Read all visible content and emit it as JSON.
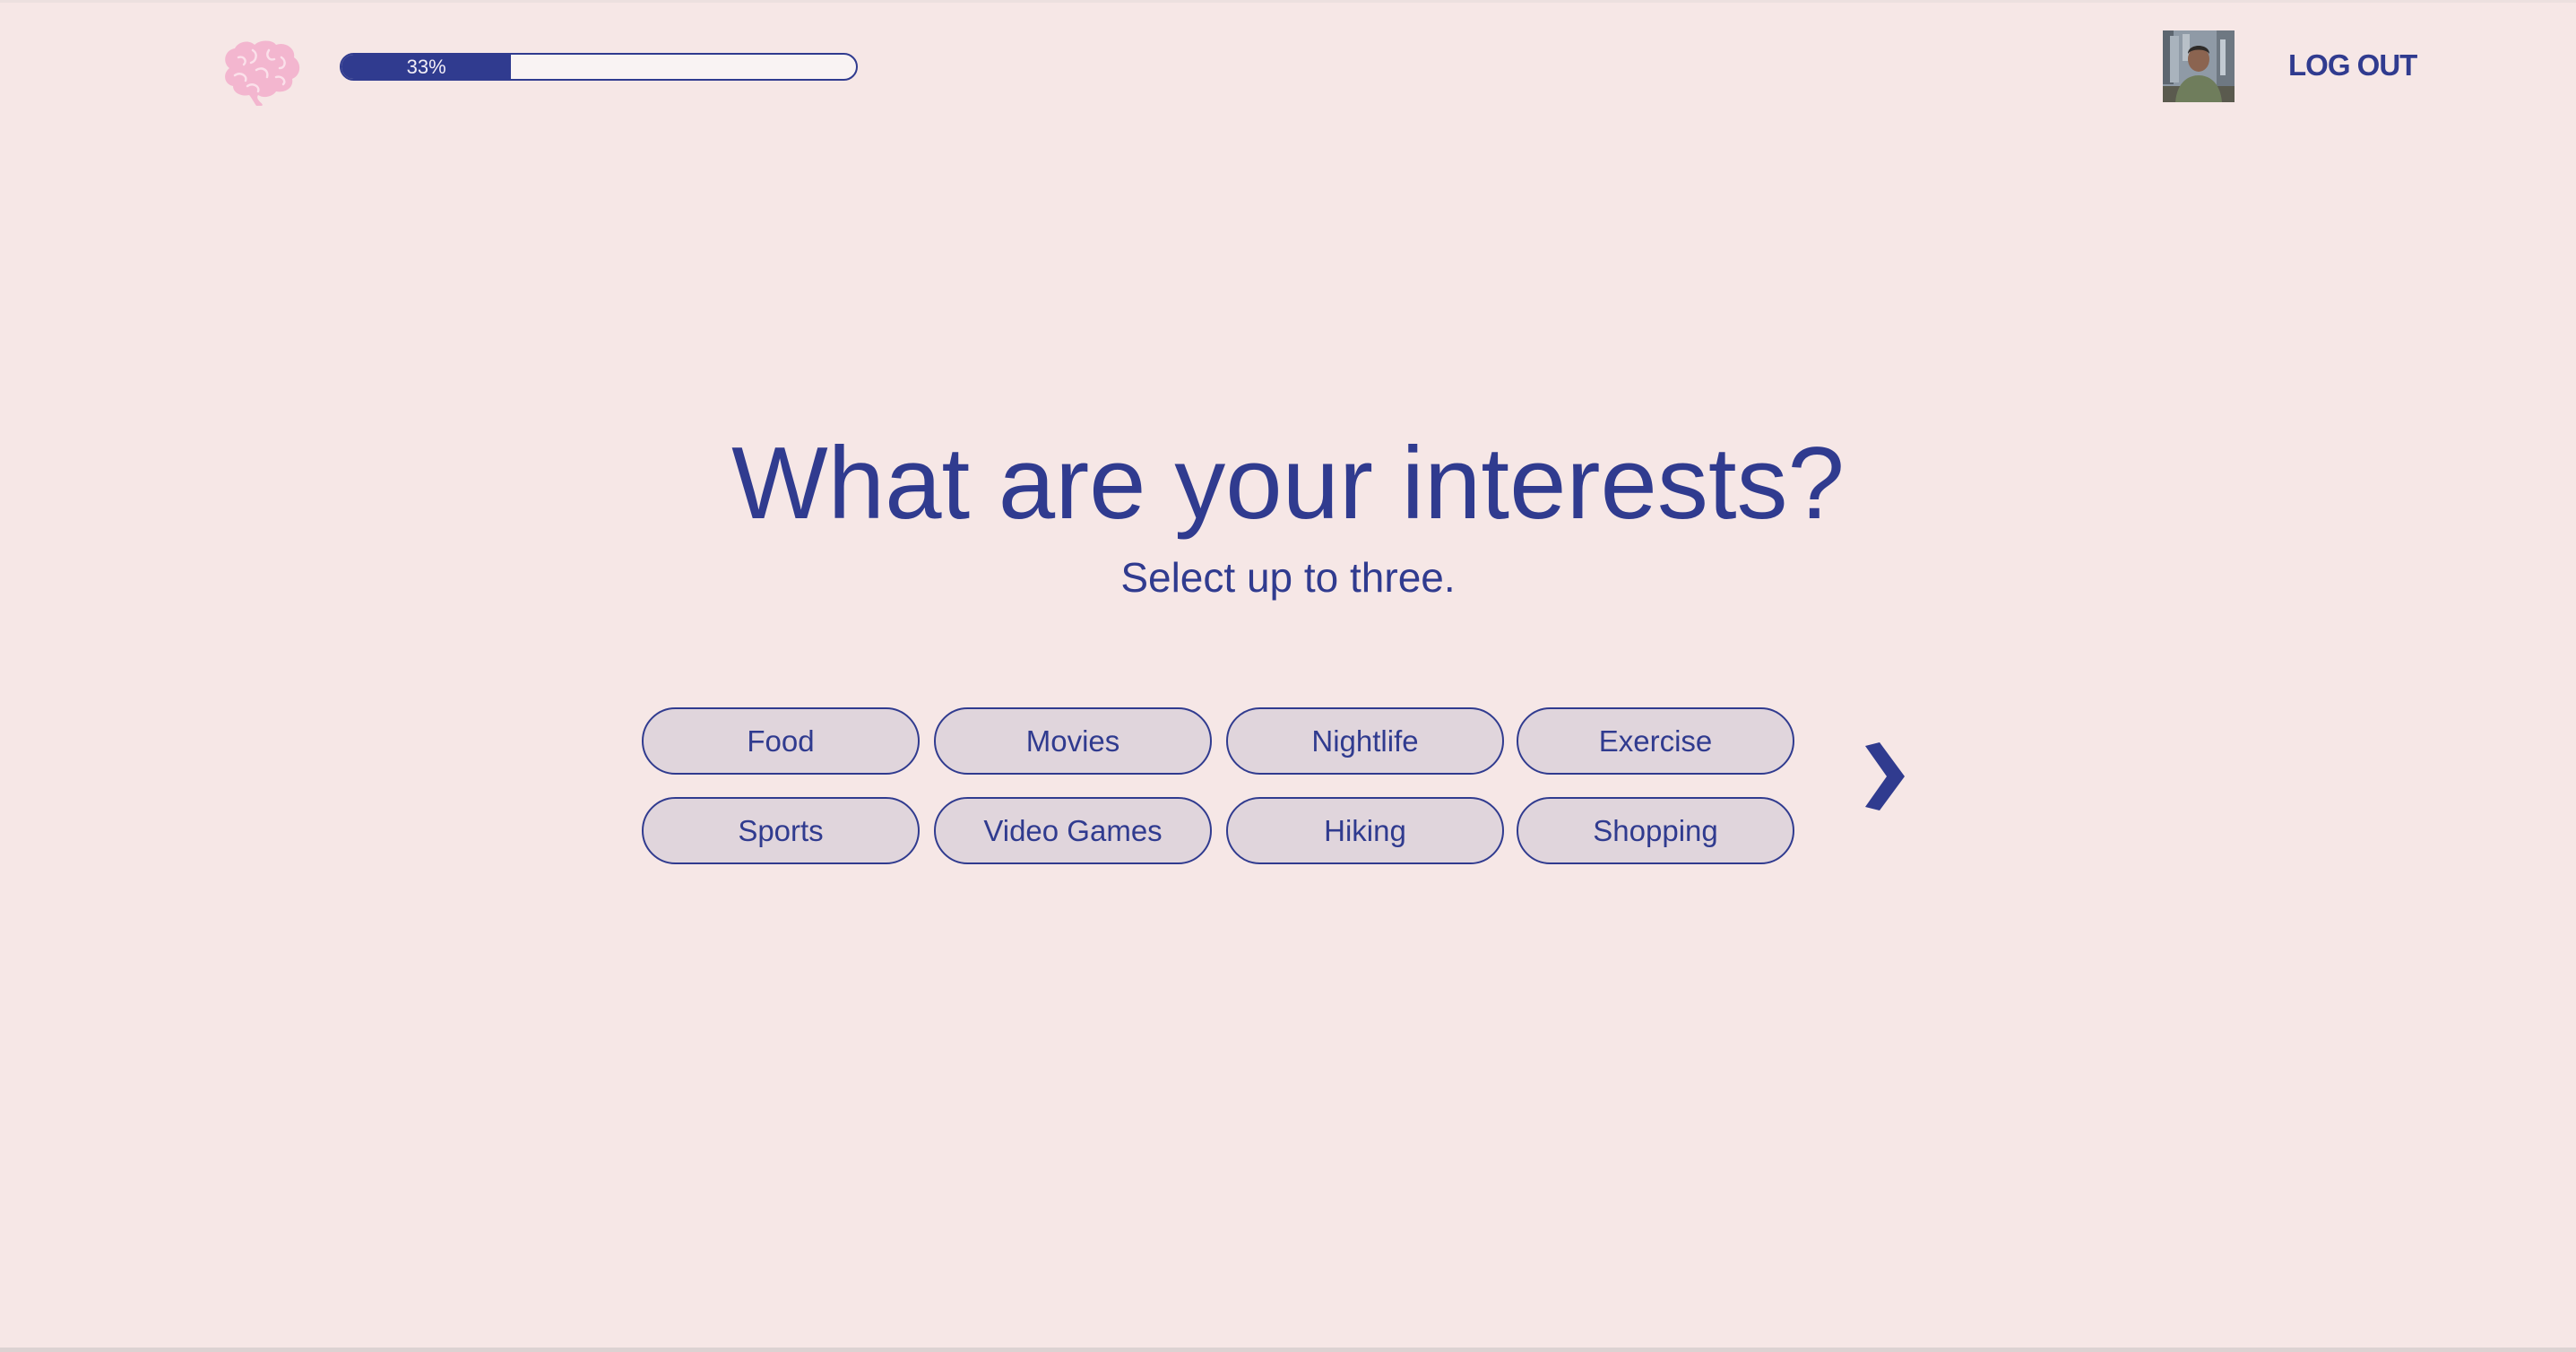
{
  "header": {
    "progress": {
      "percent": 33,
      "label": "33%"
    },
    "logout_label": "LOG OUT"
  },
  "main": {
    "title": "What are your interests?",
    "subtitle": "Select up to three.",
    "interests": [
      "Food",
      "Movies",
      "Nightlife",
      "Exercise",
      "Sports",
      "Video Games",
      "Hiking",
      "Shopping"
    ]
  },
  "icons": {
    "logo": "brain-icon",
    "next": "chevron-right-icon"
  },
  "colors": {
    "background": "#f6e7e6",
    "accent": "#303b8f",
    "chip_fill": "#e0d5dc",
    "logo": "#f3b6cf"
  }
}
